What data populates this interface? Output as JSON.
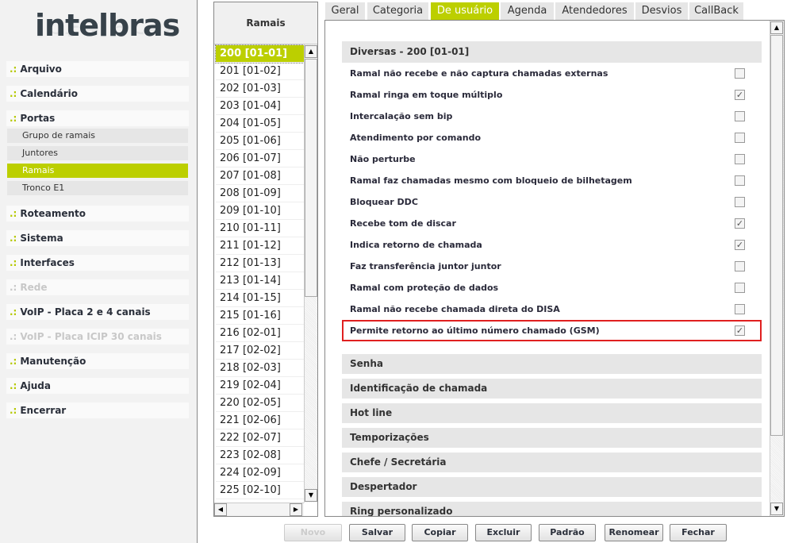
{
  "logo": "intelbras",
  "sidebar": {
    "menus": [
      {
        "label": "Arquivo",
        "disabled": false
      },
      {
        "label": "Calendário",
        "disabled": false
      },
      {
        "label": "Portas",
        "disabled": false
      },
      {
        "label": "Roteamento",
        "disabled": false
      },
      {
        "label": "Sistema",
        "disabled": false
      },
      {
        "label": "Interfaces",
        "disabled": false
      },
      {
        "label": "Rede",
        "disabled": true
      },
      {
        "label": "VoIP - Placa 2 e 4 canais",
        "disabled": false
      },
      {
        "label": "VoIP - Placa ICIP 30 canais",
        "disabled": true
      },
      {
        "label": "Manutenção",
        "disabled": false
      },
      {
        "label": "Ajuda",
        "disabled": false
      },
      {
        "label": "Encerrar",
        "disabled": false
      }
    ],
    "prefix": ".:",
    "portas_sub": [
      "Grupo de ramais",
      "Juntores",
      "Ramais",
      "Tronco E1"
    ],
    "active_sub": "Ramais"
  },
  "ramais": {
    "header": "Ramais",
    "items": [
      "200 [01-01]",
      "201 [01-02]",
      "202 [01-03]",
      "203 [01-04]",
      "204 [01-05]",
      "205 [01-06]",
      "206 [01-07]",
      "207 [01-08]",
      "208 [01-09]",
      "209 [01-10]",
      "210 [01-11]",
      "211 [01-12]",
      "212 [01-13]",
      "213 [01-14]",
      "214 [01-15]",
      "215 [01-16]",
      "216 [02-01]",
      "217 [02-02]",
      "218 [02-03]",
      "219 [02-04]",
      "220 [02-05]",
      "221 [02-06]",
      "222 [02-07]",
      "223 [02-08]",
      "224 [02-09]",
      "225 [02-10]"
    ],
    "selected": "200 [01-01]"
  },
  "tabs": [
    "Geral",
    "Categoria",
    "De usuário",
    "Agenda",
    "Atendedores",
    "Desvios",
    "CallBack"
  ],
  "active_tab": "De usuário",
  "section": {
    "title": "Diversas - 200 [01-01]",
    "options": [
      {
        "label": "Ramal não recebe e não captura chamadas externas",
        "checked": false
      },
      {
        "label": "Ramal ringa em toque múltiplo",
        "checked": true
      },
      {
        "label": "Intercalação sem bip",
        "checked": false
      },
      {
        "label": "Atendimento por comando",
        "checked": false
      },
      {
        "label": "Não perturbe",
        "checked": false
      },
      {
        "label": "Ramal faz chamadas mesmo com bloqueio de bilhetagem",
        "checked": false
      },
      {
        "label": "Bloquear DDC",
        "checked": false
      },
      {
        "label": "Recebe tom de discar",
        "checked": true
      },
      {
        "label": "Indica retorno de chamada",
        "checked": true
      },
      {
        "label": "Faz transferência juntor juntor",
        "checked": false
      },
      {
        "label": "Ramal com proteção de dados",
        "checked": false
      },
      {
        "label": "Ramal não recebe chamada direta do DISA",
        "checked": false
      },
      {
        "label": "Permite retorno ao último número chamado (GSM)",
        "checked": true,
        "highlighted": true
      }
    ]
  },
  "collapsed_sections": [
    "Senha",
    "Identificação de chamada",
    "Hot line",
    "Temporizações",
    "Chefe / Secretária",
    "Despertador",
    "Ring personalizado"
  ],
  "buttons": [
    {
      "label": "Novo",
      "disabled": true
    },
    {
      "label": "Salvar",
      "disabled": false
    },
    {
      "label": "Copiar",
      "disabled": false
    },
    {
      "label": "Excluir",
      "disabled": false
    },
    {
      "label": "Padrão",
      "disabled": false
    },
    {
      "label": "Renomear",
      "disabled": false
    },
    {
      "label": "Fechar",
      "disabled": false
    }
  ],
  "colors": {
    "accent": "#bccf00",
    "highlight_border": "#e02020"
  }
}
